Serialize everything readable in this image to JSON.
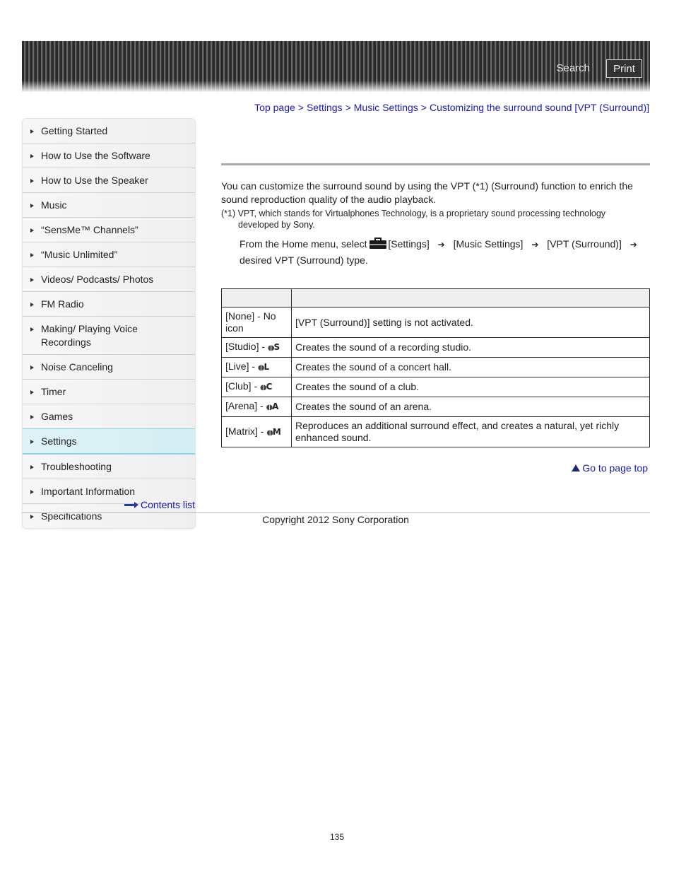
{
  "header": {
    "search_label": "Search",
    "print_label": "Print"
  },
  "breadcrumb": {
    "items": [
      "Top page",
      "Settings",
      "Music Settings",
      "Customizing the surround sound [VPT (Surround)]"
    ],
    "separator": ">"
  },
  "sidebar": {
    "items": [
      {
        "label": "Getting Started"
      },
      {
        "label": "How to Use the Software"
      },
      {
        "label": "How to Use the Speaker"
      },
      {
        "label": "Music"
      },
      {
        "label": "“SensMe™ Channels”"
      },
      {
        "label": "“Music Unlimited”"
      },
      {
        "label": "Videos/ Podcasts/ Photos"
      },
      {
        "label": "FM Radio"
      },
      {
        "label": "Making/ Playing Voice Recordings"
      },
      {
        "label": "Noise Canceling"
      },
      {
        "label": "Timer"
      },
      {
        "label": "Games"
      },
      {
        "label": "Settings",
        "active": true
      },
      {
        "label": "Troubleshooting"
      },
      {
        "label": "Important Information"
      },
      {
        "label": "Specifications"
      }
    ],
    "contents_list_label": "Contents list"
  },
  "content": {
    "intro": "You can customize the surround sound by using the VPT (*1) (Surround) function to enrich the sound reproduction quality of the audio playback.",
    "note_line1": "(*1) VPT, which stands for Virtualphones Technology, is a proprietary sound processing technology",
    "note_line2": "developed by Sony.",
    "steps": {
      "prefix": "From the Home menu, select",
      "icon": "toolbox-icon",
      "step1": "[Settings]",
      "step2": "[Music Settings]",
      "step3": "[VPT (Surround)]",
      "step4": "desired VPT (Surround) type.",
      "arrow": "➔"
    },
    "table": {
      "headers": [
        "",
        ""
      ],
      "rows": [
        {
          "setting": "[None] - No icon",
          "icon_letter": "",
          "description": "[VPT (Surround)] setting is not activated."
        },
        {
          "setting": "[Studio] - ",
          "icon_letter": "S",
          "description": "Creates the sound of a recording studio."
        },
        {
          "setting": "[Live] - ",
          "icon_letter": "L",
          "description": "Creates the sound of a concert hall."
        },
        {
          "setting": "[Club] - ",
          "icon_letter": "C",
          "description": "Creates the sound of a club."
        },
        {
          "setting": "[Arena] - ",
          "icon_letter": "A",
          "description": "Creates the sound of an arena."
        },
        {
          "setting": "[Matrix] - ",
          "icon_letter": "M",
          "description": "Reproduces an additional surround effect, and creates a natural, yet richly enhanced sound."
        }
      ]
    },
    "page_top_label": "Go to page top"
  },
  "footer": {
    "copyright": "Copyright 2012 Sony Corporation",
    "page_number": "135"
  }
}
